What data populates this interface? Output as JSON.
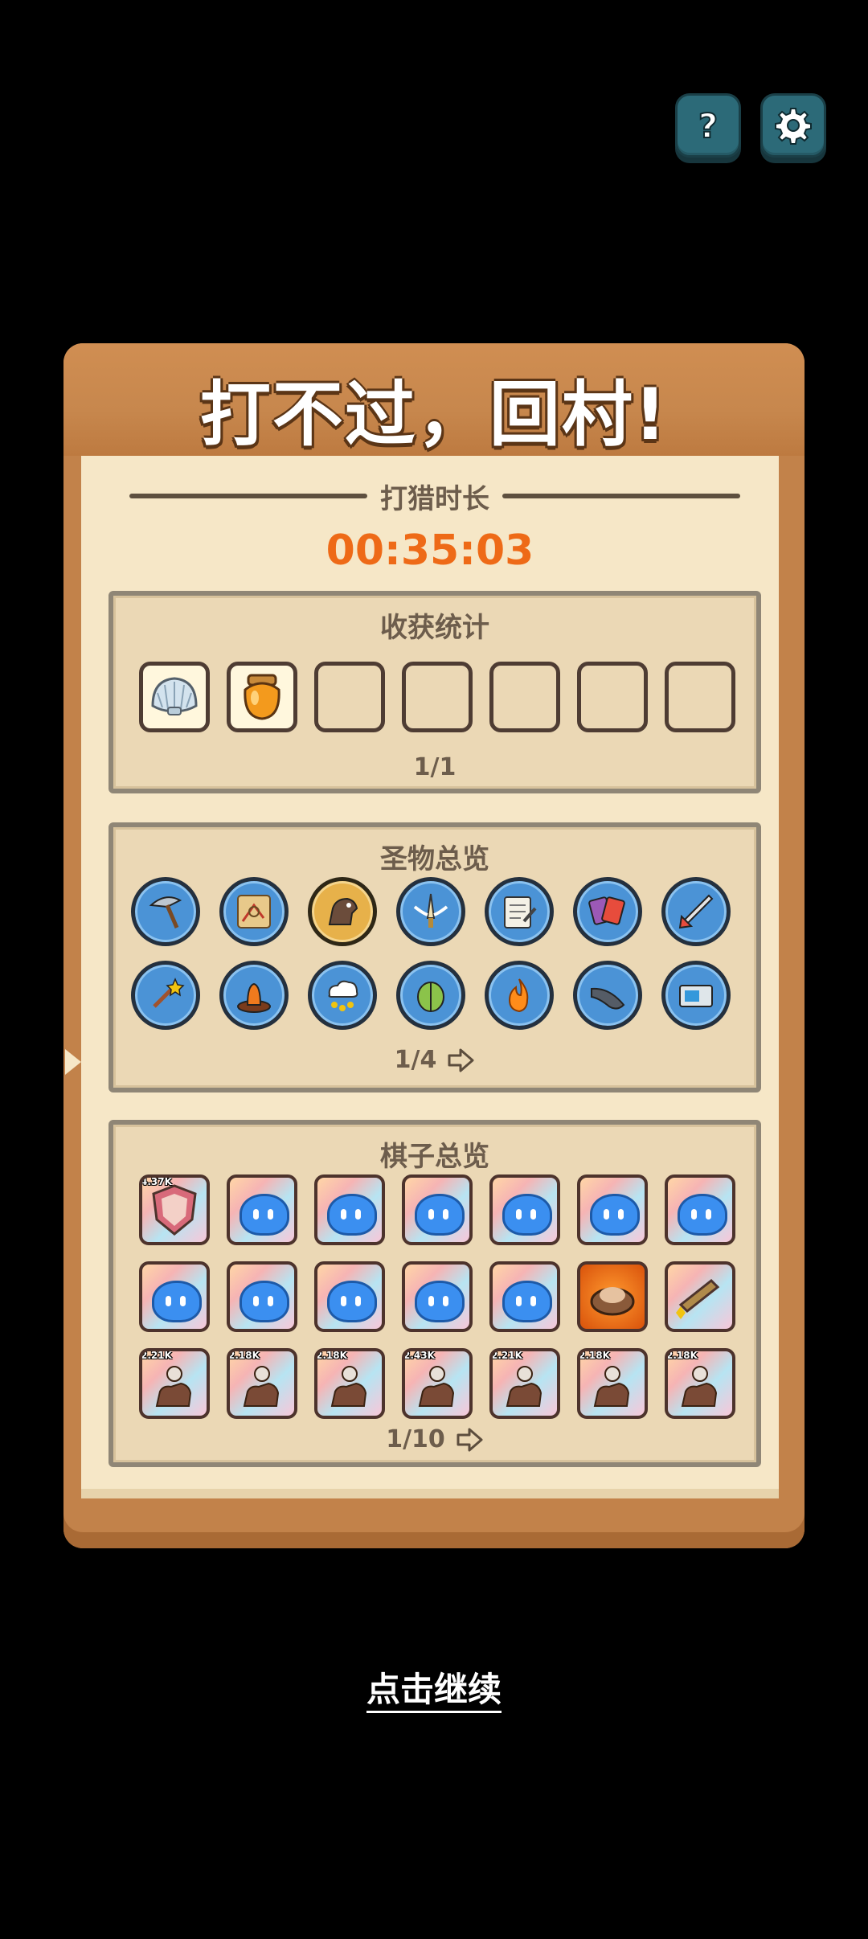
{
  "top_buttons": {
    "help_icon": "question-icon",
    "settings_icon": "gear-icon"
  },
  "panel": {
    "title": "打不过，回村!",
    "hunt_label": "打猎时长",
    "hunt_time": "00:35:03"
  },
  "harvest": {
    "title": "收获统计",
    "slots": [
      "shell",
      "honey-jar",
      "",
      "",
      "",
      "",
      ""
    ],
    "pager": "1/1"
  },
  "relics": {
    "title": "圣物总览",
    "items": [
      "pickaxe-icon",
      "map-icon",
      "horse-icon",
      "sword-icon",
      "scroll-icon",
      "cards-icon",
      "rocket-sword-icon",
      "magic-wand-icon",
      "carrot-icon",
      "rain-cloud-icon",
      "beetle-icon",
      "fire-icon",
      "horn-icon",
      "radio-icon"
    ],
    "pager": "1/4"
  },
  "pieces": {
    "title": "棋子总览",
    "row1": [
      {
        "type": "shield",
        "badge": "4.37K"
      },
      {
        "type": "blob"
      },
      {
        "type": "blob"
      },
      {
        "type": "blob"
      },
      {
        "type": "blob"
      },
      {
        "type": "blob"
      },
      {
        "type": "blob"
      }
    ],
    "row2": [
      {
        "type": "blob"
      },
      {
        "type": "blob"
      },
      {
        "type": "blob"
      },
      {
        "type": "blob"
      },
      {
        "type": "blob"
      },
      {
        "type": "nest"
      },
      {
        "type": "cannon"
      }
    ],
    "row3": [
      {
        "type": "knight",
        "badge": "2.21K"
      },
      {
        "type": "knight",
        "badge": "2.18K"
      },
      {
        "type": "knight",
        "badge": "2.18K"
      },
      {
        "type": "knight",
        "badge": "2.43K"
      },
      {
        "type": "knight",
        "badge": "2.21K"
      },
      {
        "type": "knight",
        "badge": "2.18K"
      },
      {
        "type": "knight",
        "badge": "2.18K"
      }
    ],
    "pager": "1/10"
  },
  "continue_label": "点击继续",
  "colors": {
    "background": "#000000",
    "wood": "#c2824a",
    "paper": "#f6e7c7",
    "timer": "#ee6a17",
    "blob": "#3b8ff0"
  }
}
